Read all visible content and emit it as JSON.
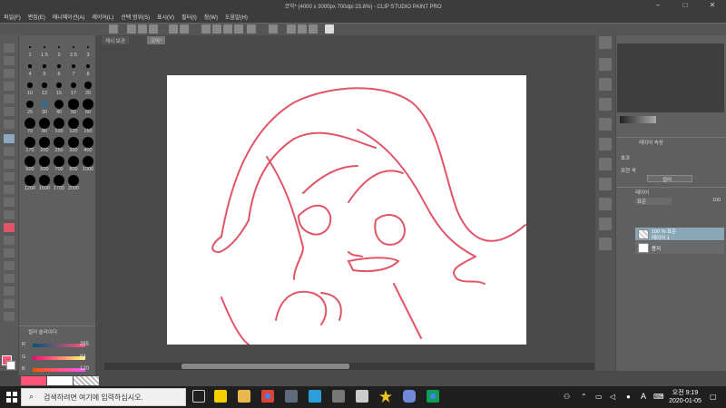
{
  "window": {
    "title": "코믹* (4000 x 3000px 700dpi 23.8%) - CLIP STUDIO PAINT PRO"
  },
  "menu": [
    "파일(F)",
    "편집(E)",
    "애니메이션(A)",
    "레이어(L)",
    "선택 범위(S)",
    "표시(V)",
    "필터(I)",
    "창(W)",
    "도움말(H)"
  ],
  "tabs": [
    "캐시 보관",
    "코믹*"
  ],
  "brush_sizes": [
    "1",
    "1.5",
    "2",
    "2.5",
    "3",
    "4",
    "5",
    "6",
    "7",
    "8",
    "10",
    "12",
    "15",
    "17",
    "20",
    "25",
    "30",
    "40",
    "50",
    "60",
    "70",
    "80",
    "100",
    "120",
    "150",
    "170",
    "200",
    "250",
    "300",
    "400",
    "500",
    "600",
    "700",
    "800",
    "1000",
    "1200",
    "1500",
    "1700",
    "2000"
  ],
  "color_slider": {
    "title": "컬러 슬라이더",
    "r": "255",
    "g": "84",
    "b": "120",
    "accent": "#ff5478"
  },
  "props": {
    "title": "레이어 속성",
    "effect": "효과",
    "expression": "표현 색",
    "color_label": "컬러"
  },
  "layers": {
    "title": "레이어",
    "blend": "표준",
    "opacity": "100",
    "items": [
      {
        "name": "100 % 표준",
        "sub": "레이어 1"
      },
      {
        "name": "용지"
      }
    ]
  },
  "taskbar": {
    "search_placeholder": "검색하려면 여기에 입력하십시오.",
    "time": "오전 9:19",
    "date": "2020-01-05",
    "lang": "A"
  },
  "stroke_color": "#e05567"
}
